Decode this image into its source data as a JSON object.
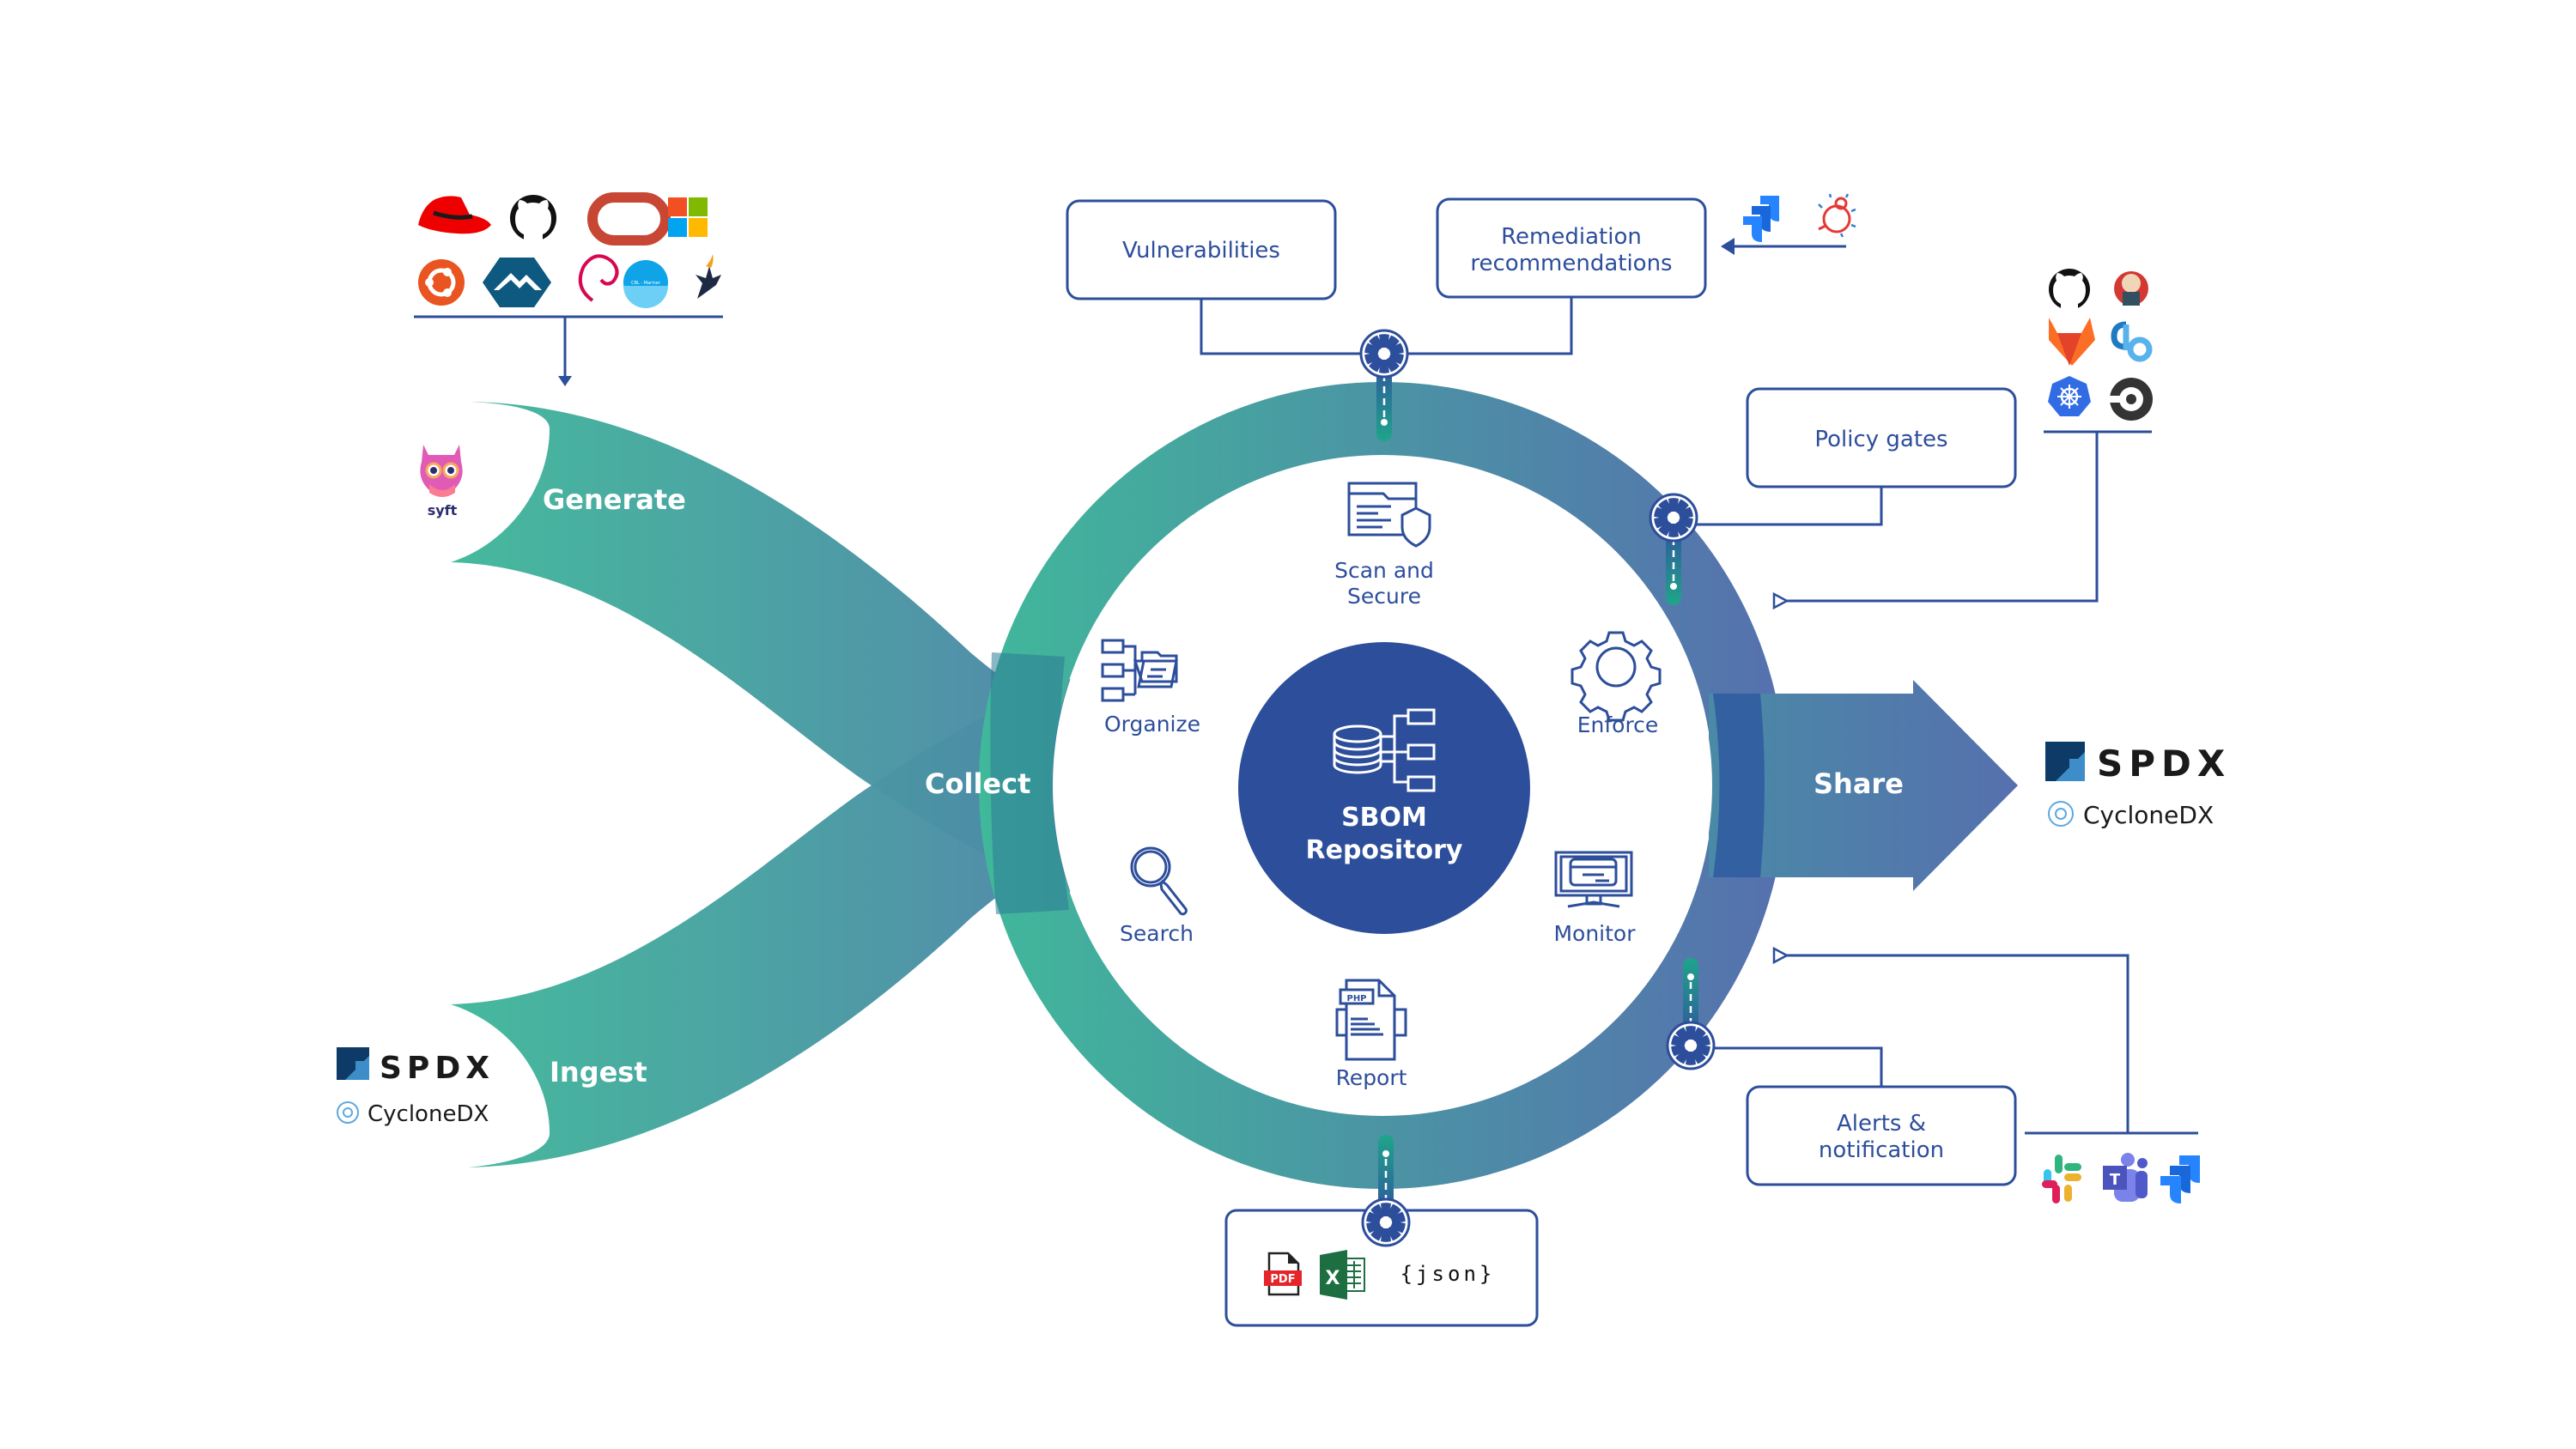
{
  "flows": {
    "generate": "Generate",
    "ingest": "Ingest",
    "collect": "Collect",
    "share": "Share"
  },
  "center": {
    "line1": "SBOM",
    "line2": "Repository"
  },
  "capabilities": [
    {
      "id": "scan",
      "line1": "Scan and",
      "line2": "Secure",
      "icon": "browser-shield-icon"
    },
    {
      "id": "enforce",
      "line1": "Enforce",
      "icon": "gear-icon"
    },
    {
      "id": "monitor",
      "line1": "Monitor",
      "icon": "monitor-icon"
    },
    {
      "id": "report",
      "line1": "Report",
      "icon": "report-document-icon"
    },
    {
      "id": "search",
      "line1": "Search",
      "icon": "magnifier-icon"
    },
    {
      "id": "organize",
      "line1": "Organize",
      "icon": "folder-tree-icon"
    }
  ],
  "boxes": {
    "vulnerabilities": "Vulnerabilities",
    "remediation_line1": "Remediation",
    "remediation_line2": "recommendations",
    "policy_gates": "Policy gates",
    "alerts_line1": "Alerts &",
    "alerts_line2": "notification",
    "export_json": "{json}",
    "export_pdf": "PDF",
    "export_excel": "X"
  },
  "sources": {
    "os_logos": [
      "redhat",
      "github",
      "oracle",
      "microsoft",
      "ubuntu",
      "alpine",
      "debian",
      "cbl-mariner",
      "wolfi"
    ],
    "cbl_mariner_text": "CBL - Mariner",
    "syft": "syft"
  },
  "formats": {
    "spdx": "SPDX",
    "cyclonedx": "CycloneDX"
  },
  "integrations": {
    "remediation_tools": [
      "jira",
      "bug-tracker"
    ],
    "ci_tools": [
      "github",
      "jenkins",
      "gitlab",
      "codefresh",
      "kubernetes",
      "circleci"
    ],
    "notify_tools": [
      "slack",
      "teams",
      "jira"
    ],
    "teams_letter": "T",
    "php_label": "PHP"
  },
  "colors": {
    "teal": "#40B89A",
    "blue": "#5670AE",
    "navy": "#2D4E9B"
  }
}
